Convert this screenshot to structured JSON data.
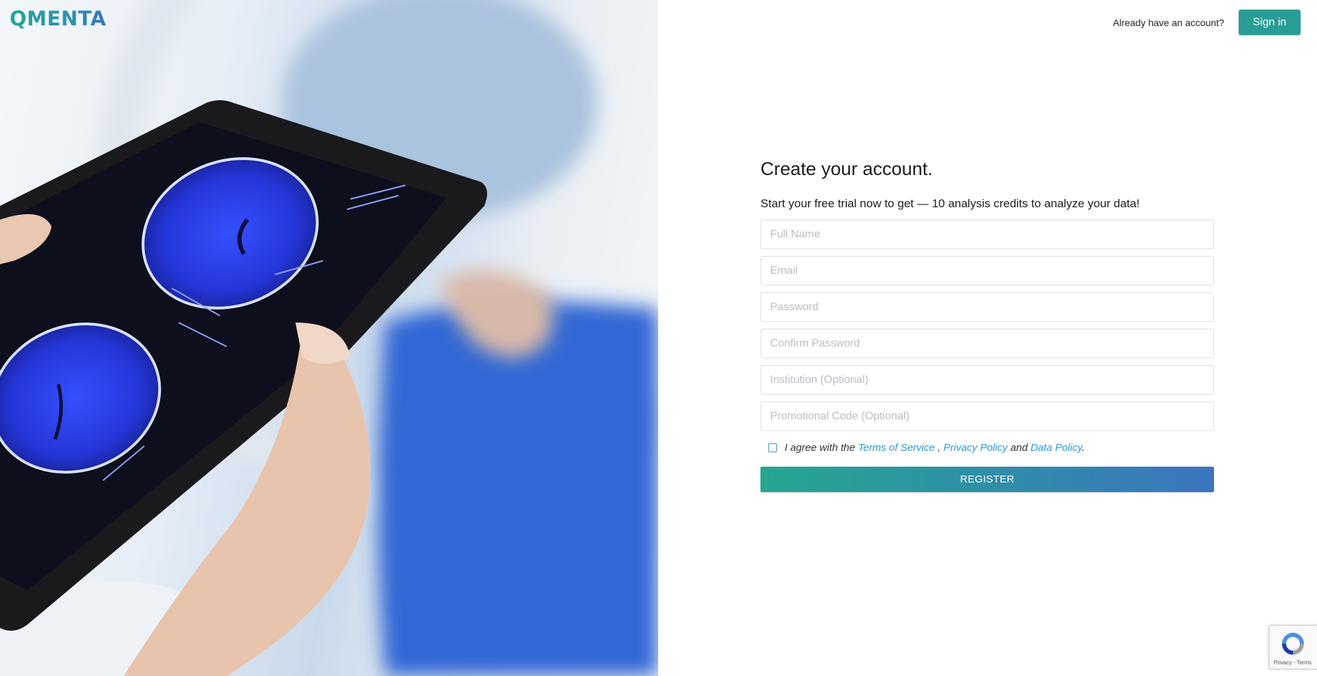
{
  "brand": {
    "logo_text": "QMENTA"
  },
  "topbar": {
    "prompt": "Already have an account?",
    "signin_label": "Sign in"
  },
  "form": {
    "title": "Create your account.",
    "subtitle": "Start your free trial now to get — 10 analysis credits to analyze your data!",
    "fields": {
      "full_name": "Full Name",
      "email": "Email",
      "password": "Password",
      "confirm_password": "Confirm Password",
      "institution": "Institution (Optional)",
      "promo_code": "Promotional Code (Optional)"
    },
    "agree": {
      "prefix": "I agree with the",
      "terms": "Terms of Service",
      "comma": ",",
      "privacy": "Privacy Policy",
      "and": "and",
      "data_policy": "Data Policy",
      "suffix": "."
    },
    "register_label": "REGISTER"
  },
  "recaptcha": {
    "links": "Privacy - Terms"
  },
  "colors": {
    "brand_teal": "#2a9d95",
    "brand_blue": "#3b74c0",
    "link": "#2a9ad4"
  },
  "icons": [
    "recaptcha-icon",
    "checkbox-icon"
  ]
}
